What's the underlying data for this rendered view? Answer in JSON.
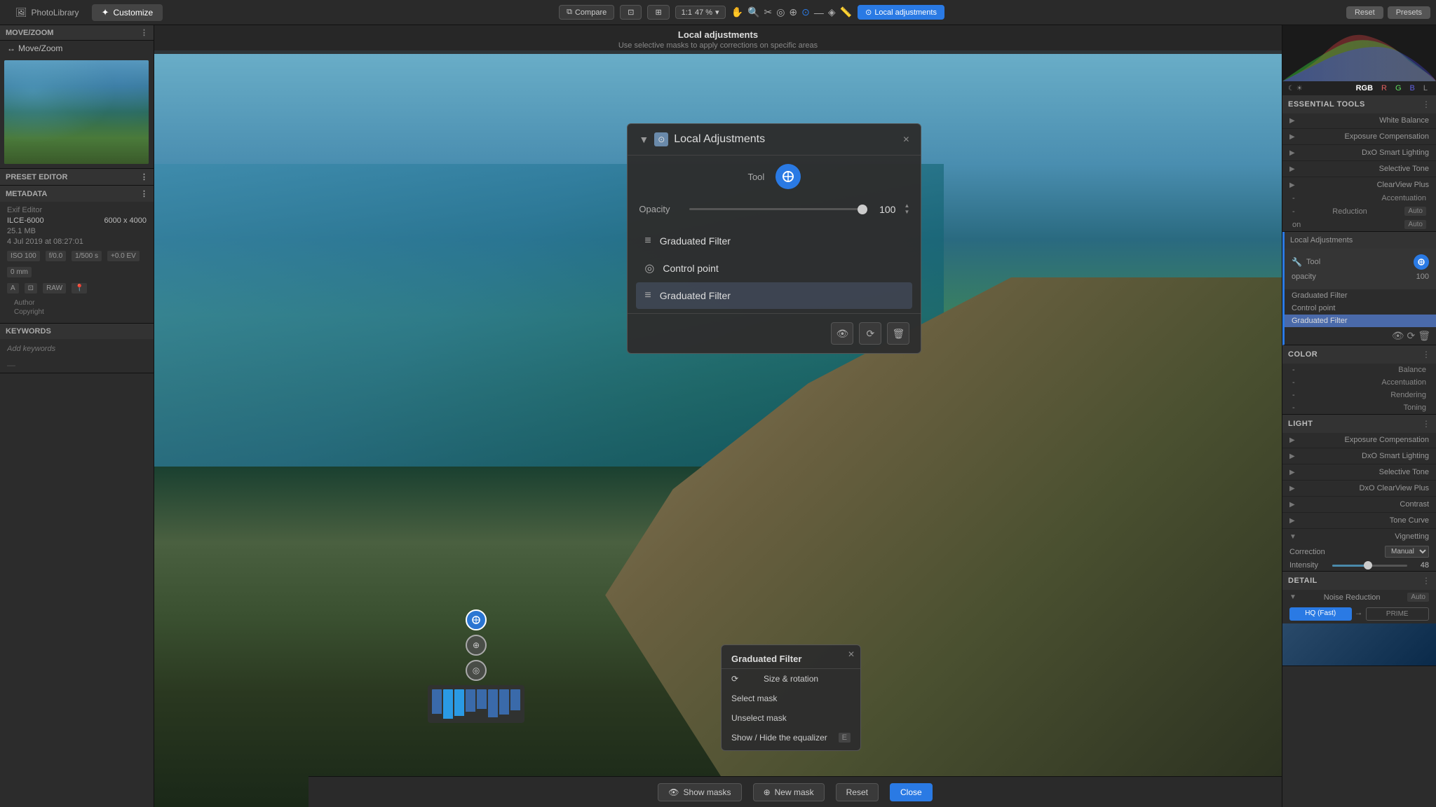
{
  "app": {
    "tabs": [
      {
        "label": "PhotoLibrary",
        "icon": "🖼",
        "active": false
      },
      {
        "label": "Customize",
        "icon": "✦",
        "active": true
      }
    ]
  },
  "toolbar": {
    "compare_label": "Compare",
    "zoom_level": "47 %",
    "ratio": "1:1",
    "local_adjustments_label": "Local adjustments",
    "reset_label": "Reset",
    "presets_label": "Presets"
  },
  "left_panel": {
    "move_zoom_title": "MOVE/ZOOM",
    "move_zoom_label": "Move/Zoom",
    "preset_editor_title": "PRESET EDITOR",
    "metadata_title": "METADATA",
    "exif_editor_label": "Exif Editor",
    "camera_model": "ILCE-6000",
    "dimensions": "6000 x 4000",
    "file_size": "25.1 MB",
    "date_taken": "4 Jul 2019 at 08:27:01",
    "iso": "ISO 100",
    "aperture": "f/0.0",
    "shutter": "1/500 s",
    "ev": "+0.0 EV",
    "focal": "0 mm",
    "format": "RAW",
    "author_label": "Author",
    "copyright_label": "Copyright",
    "keywords_title": "Keywords",
    "keywords_placeholder": "Add keywords"
  },
  "local_adjustments": {
    "header_title": "Local adjustments",
    "header_subtitle": "Use selective masks to apply corrections on specific areas",
    "popup_title": "Local Adjustments",
    "tool_label": "Tool",
    "opacity_label": "Opacity",
    "opacity_value": "100",
    "items": [
      {
        "label": "Graduated Filter",
        "type": "filter"
      },
      {
        "label": "Control point",
        "type": "control"
      },
      {
        "label": "Graduated Filter",
        "type": "filter",
        "selected": true
      }
    ]
  },
  "context_menu": {
    "title": "Graduated Filter",
    "items": [
      {
        "label": "Size & rotation",
        "icon": "⟳"
      },
      {
        "label": "Select mask",
        "shortcut": ""
      },
      {
        "label": "Unselect mask",
        "shortcut": ""
      },
      {
        "label": "Show / Hide the equalizer",
        "shortcut": "E"
      }
    ]
  },
  "bottom_bar": {
    "show_masks_label": "Show masks",
    "new_mask_label": "New mask",
    "reset_label": "Reset",
    "close_label": "Close"
  },
  "right_panel": {
    "essential_tools_title": "ESSENTIAL TOOLS",
    "tools": [
      {
        "label": "White Balance",
        "expanded": false
      },
      {
        "label": "Exposure Compensation",
        "expanded": false
      },
      {
        "label": "DxO Smart Lighting",
        "expanded": false
      },
      {
        "label": "Selective Tone",
        "expanded": false
      },
      {
        "label": "ClearView Plus",
        "expanded": false
      },
      {
        "label": "Accentuation",
        "sub": true
      },
      {
        "label": "Reduction",
        "sub": true,
        "value": "Auto"
      },
      {
        "label": "on",
        "sub": true,
        "value": "Auto"
      }
    ],
    "local_adj_section": {
      "title": "Local Adjustments",
      "tool_label": "Tool",
      "opacity_label": "opacity",
      "opacity_value": "100",
      "list_items": [
        "Graduated Filter",
        "Control point",
        "Graduated Filter"
      ],
      "active_item": 2
    },
    "color_title": "COLOR",
    "color_tools": [
      {
        "label": "Balance"
      },
      {
        "label": "Accentuation"
      },
      {
        "label": "Rendering"
      },
      {
        "label": "Toning"
      }
    ],
    "light_title": "LIGHT",
    "light_tools": [
      {
        "label": "Exposure Compensation"
      },
      {
        "label": "DxO Smart Lighting"
      },
      {
        "label": "Selective Tone"
      },
      {
        "label": "DxO ClearView Plus"
      },
      {
        "label": "Contrast"
      },
      {
        "label": "Tone Curve"
      },
      {
        "label": "Vignetting",
        "expanded": true
      }
    ],
    "vignetting": {
      "correction_label": "Correction",
      "correction_value": "Manual",
      "intensity_label": "Intensity",
      "intensity_value": "48"
    },
    "detail_title": "DETAIL",
    "noise_reduction_label": "Noise Reduction",
    "noise_reduction_value": "Auto",
    "nr_hq_label": "HQ (Fast)",
    "nr_prime_label": "PRIME"
  }
}
